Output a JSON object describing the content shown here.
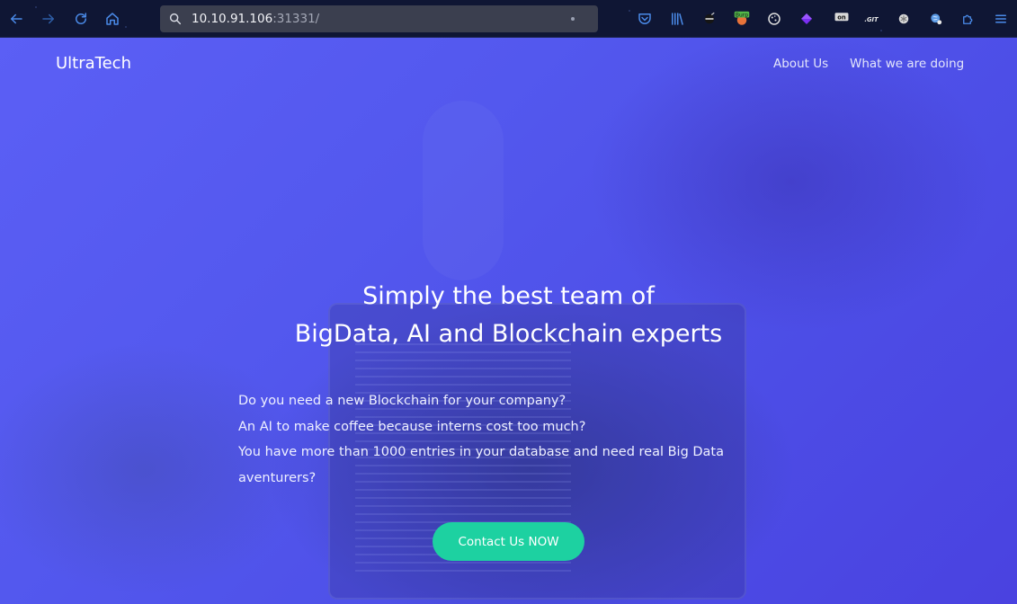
{
  "browser": {
    "url_host": "10.10.91.106",
    "url_port": ":31331/",
    "toolbar_icons": [
      "back-icon",
      "forward-icon",
      "reload-icon",
      "home-icon",
      "search-icon"
    ],
    "extensions": [
      {
        "icon": "pocket-icon"
      },
      {
        "icon": "library-icon"
      },
      {
        "icon": "ninja-extension-icon"
      },
      {
        "icon": "burp-extension-icon",
        "badge": "Burp"
      },
      {
        "icon": "cookie-icon"
      },
      {
        "icon": "purple-gem-icon"
      },
      {
        "icon": "toggle-on-icon",
        "badge": "on"
      },
      {
        "icon": "git-extension-icon",
        "badge": ".GIT"
      },
      {
        "icon": "snowflake-icon"
      },
      {
        "icon": "globe-search-icon"
      },
      {
        "icon": "puzzle-extensions-icon"
      },
      {
        "icon": "hamburger-menu-icon"
      }
    ],
    "colors": {
      "toolbar_bg": "#0f1634",
      "icon_blue": "#4a8ae8",
      "urlbar_bg": "#3b3f4f"
    }
  },
  "page": {
    "brand": "UltraTech",
    "nav": [
      {
        "label": "About Us"
      },
      {
        "label": "What we are doing"
      }
    ],
    "hero": {
      "title_line1": "Simply the best team of",
      "title_line2": "BigData, AI and Blockchain experts",
      "lines": [
        "Do you need a new Blockchain for your company?",
        "An AI to make coffee because interns cost too much?",
        "You have more than 1000 entries in your database and need real Big Data aventurers?"
      ],
      "cta_label": "Contact Us NOW"
    },
    "colors": {
      "accent": "#1dd1a1",
      "background": "#5358ee"
    }
  }
}
